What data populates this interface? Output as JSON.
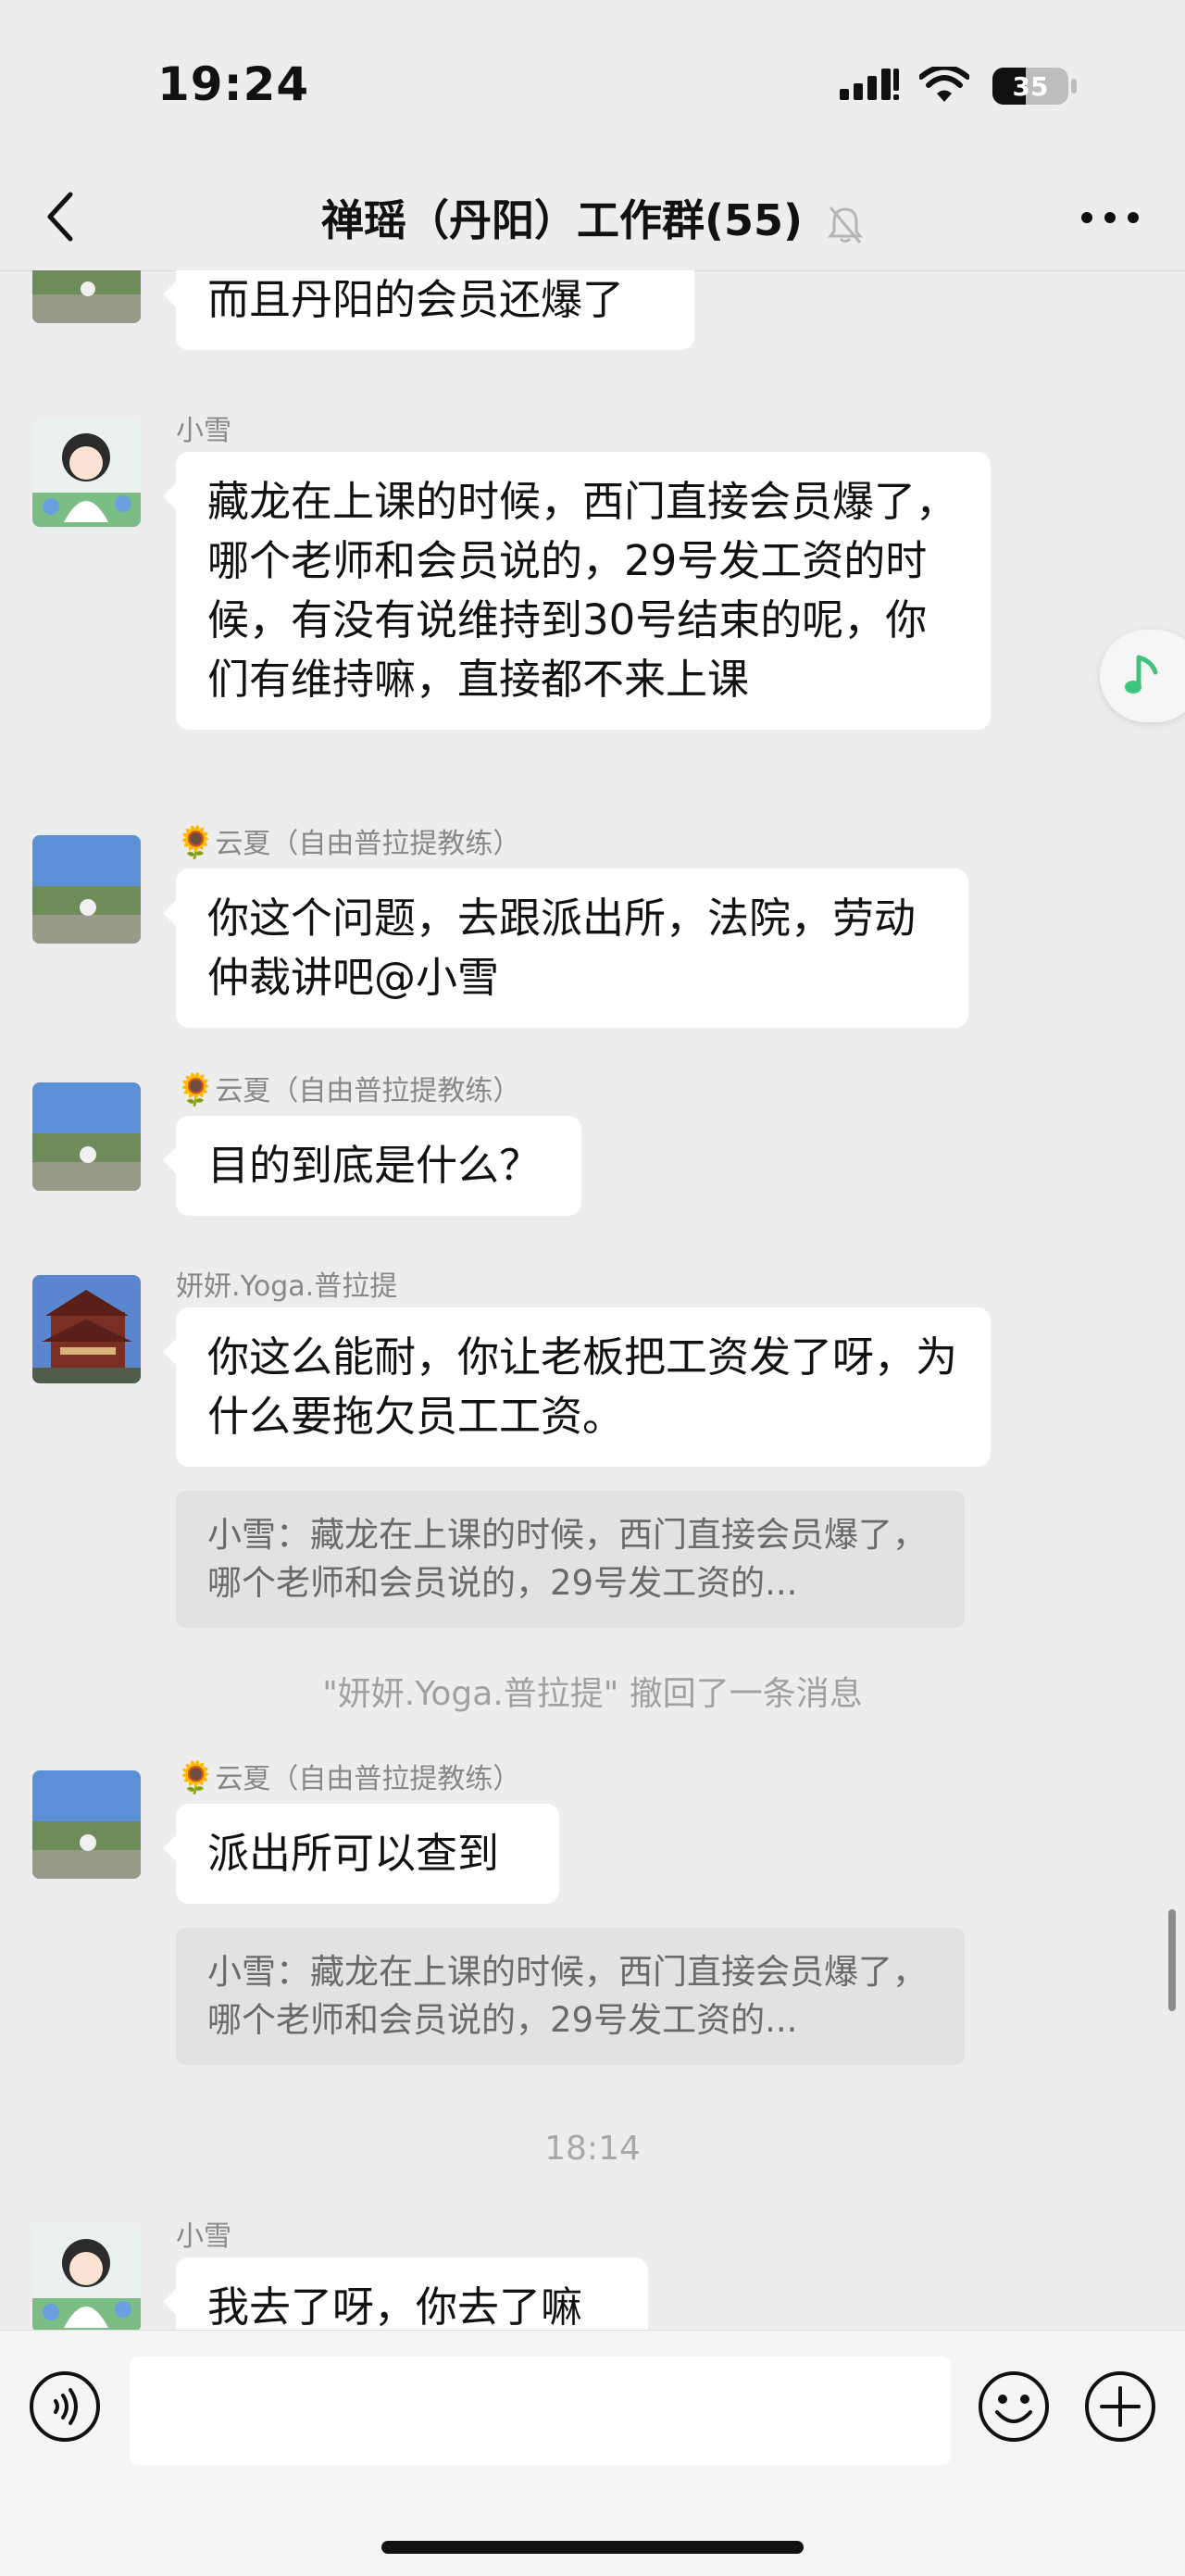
{
  "status_bar": {
    "time": "19:24",
    "battery": "35"
  },
  "nav": {
    "title": "禅瑶（丹阳）工作群(55)"
  },
  "messages": [
    {
      "text": "而且丹阳的会员还爆了"
    },
    {
      "sender": "小雪",
      "text": "藏龙在上课的时候，西门直接会员爆了，哪个老师和会员说的，29号发工资的时候，有没有说维持到30号结束的呢，你们有维持嘛，直接都不来上课"
    },
    {
      "sender_emoji": "🌻",
      "sender": "云夏（自由普拉提教练）",
      "text": "你这个问题，去跟派出所，法院，劳动仲裁讲吧@小雪"
    },
    {
      "sender_emoji": "🌻",
      "sender": "云夏（自由普拉提教练）",
      "text": "目的到底是什么？"
    },
    {
      "sender": "妍妍.Yoga.普拉提",
      "text": "你这么能耐，你让老板把工资发了呀，为什么要拖欠员工工资。",
      "quote": "小雪：藏龙在上课的时候，西门直接会员爆了，哪个老师和会员说的，29号发工资的..."
    },
    {
      "system": "\"妍妍.Yoga.普拉提\" 撤回了一条消息"
    },
    {
      "sender_emoji": "🌻",
      "sender": "云夏（自由普拉提教练）",
      "text": "派出所可以查到",
      "quote": "小雪：藏龙在上课的时候，西门直接会员爆了，哪个老师和会员说的，29号发工资的..."
    },
    {
      "time_separator": "18:14"
    },
    {
      "sender": "小雪",
      "text": "我去了呀，你去了嘛"
    }
  ],
  "input": {
    "value": ""
  },
  "icons": {
    "back": "chevron-left-icon",
    "mute": "bell-off-icon",
    "more": "more-dots-icon",
    "music": "music-note-icon",
    "voice": "voice-icon",
    "emoji": "emoji-icon",
    "plus": "plus-icon"
  },
  "colors": {
    "background": "#ededed",
    "bubble": "#ffffff",
    "quote": "#e2e2e2",
    "music_accent": "#3cc47c"
  }
}
